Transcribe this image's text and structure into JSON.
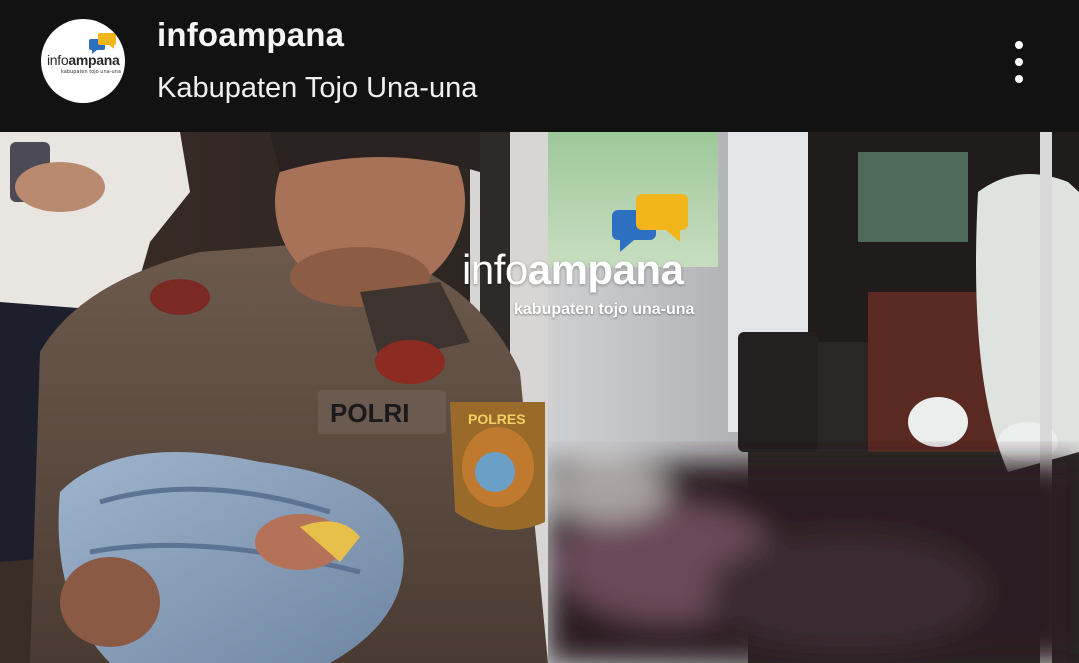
{
  "header": {
    "account_name": "infoampana",
    "location": "Kabupaten Tojo Una-una",
    "avatar_logo": {
      "word_light": "info",
      "word_bold": "ampana",
      "tagline": "kabupaten tojo una-una"
    },
    "more_icon": "more-vertical-icon"
  },
  "post_image": {
    "uniform_text": "POLRI",
    "badge_text": "POLRES",
    "watermark": {
      "word_light": "info",
      "word_bold": "ampana",
      "tagline": "kabupaten tojo una-una"
    }
  },
  "colors": {
    "header_bg": "#121212",
    "brand_blue": "#2d6fc0",
    "brand_yellow": "#f2b51c"
  }
}
